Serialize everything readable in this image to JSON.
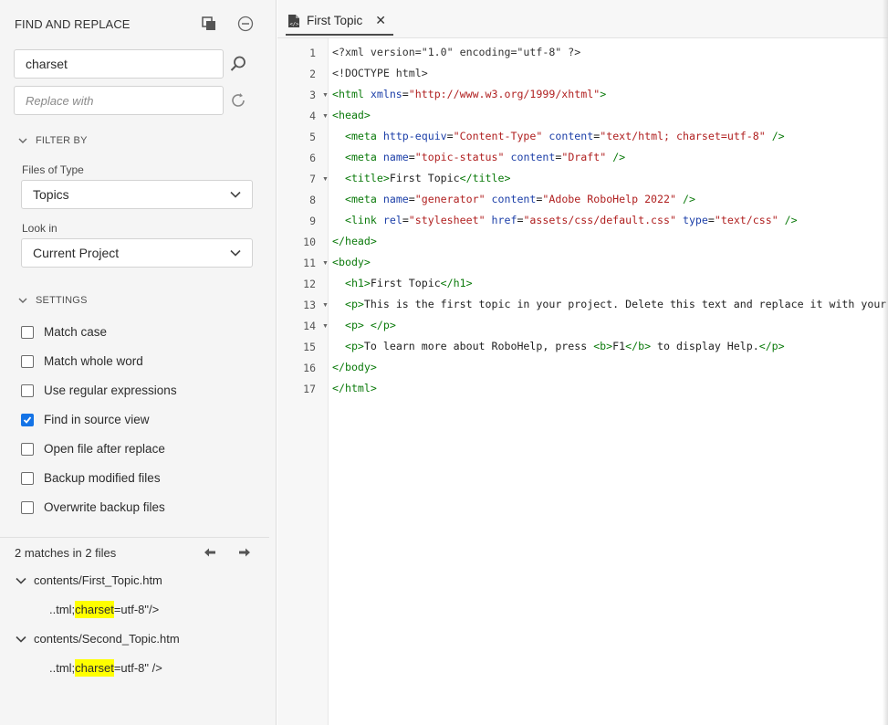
{
  "panel": {
    "title": "FIND AND REPLACE",
    "find_value": "charset",
    "replace_placeholder": "Replace with",
    "filter_by": {
      "heading": "FILTER BY",
      "files_label": "Files of Type",
      "files_value": "Topics",
      "lookin_label": "Look in",
      "lookin_value": "Current Project"
    },
    "settings": {
      "heading": "SETTINGS",
      "options": [
        {
          "label": "Match case",
          "checked": false
        },
        {
          "label": "Match whole word",
          "checked": false
        },
        {
          "label": "Use regular expressions",
          "checked": false
        },
        {
          "label": "Find in source view",
          "checked": true
        },
        {
          "label": "Open file after replace",
          "checked": false
        },
        {
          "label": "Backup modified files",
          "checked": false
        },
        {
          "label": "Overwrite backup files",
          "checked": false
        }
      ]
    },
    "results": {
      "summary": "2 matches in 2 files",
      "files": [
        {
          "path": "contents/First_Topic.htm",
          "before": "..tml;",
          "match": "charset",
          "after": "=utf-8\"/>"
        },
        {
          "path": "contents/Second_Topic.htm",
          "before": "..tml;",
          "match": "charset",
          "after": "=utf-8\" />"
        }
      ]
    }
  },
  "editor": {
    "tab_title": "First Topic",
    "lines": [
      "1",
      "2",
      "3",
      "4",
      "5",
      "6",
      "7",
      "8",
      "9",
      "10",
      "11",
      "12",
      "13",
      "14",
      "15",
      "16",
      "17"
    ]
  },
  "colors": {
    "accent": "#1473e6",
    "highlight": "#ffff00",
    "tag": "#0b7a0b",
    "attr": "#1c3fa8",
    "string": "#b02020"
  }
}
